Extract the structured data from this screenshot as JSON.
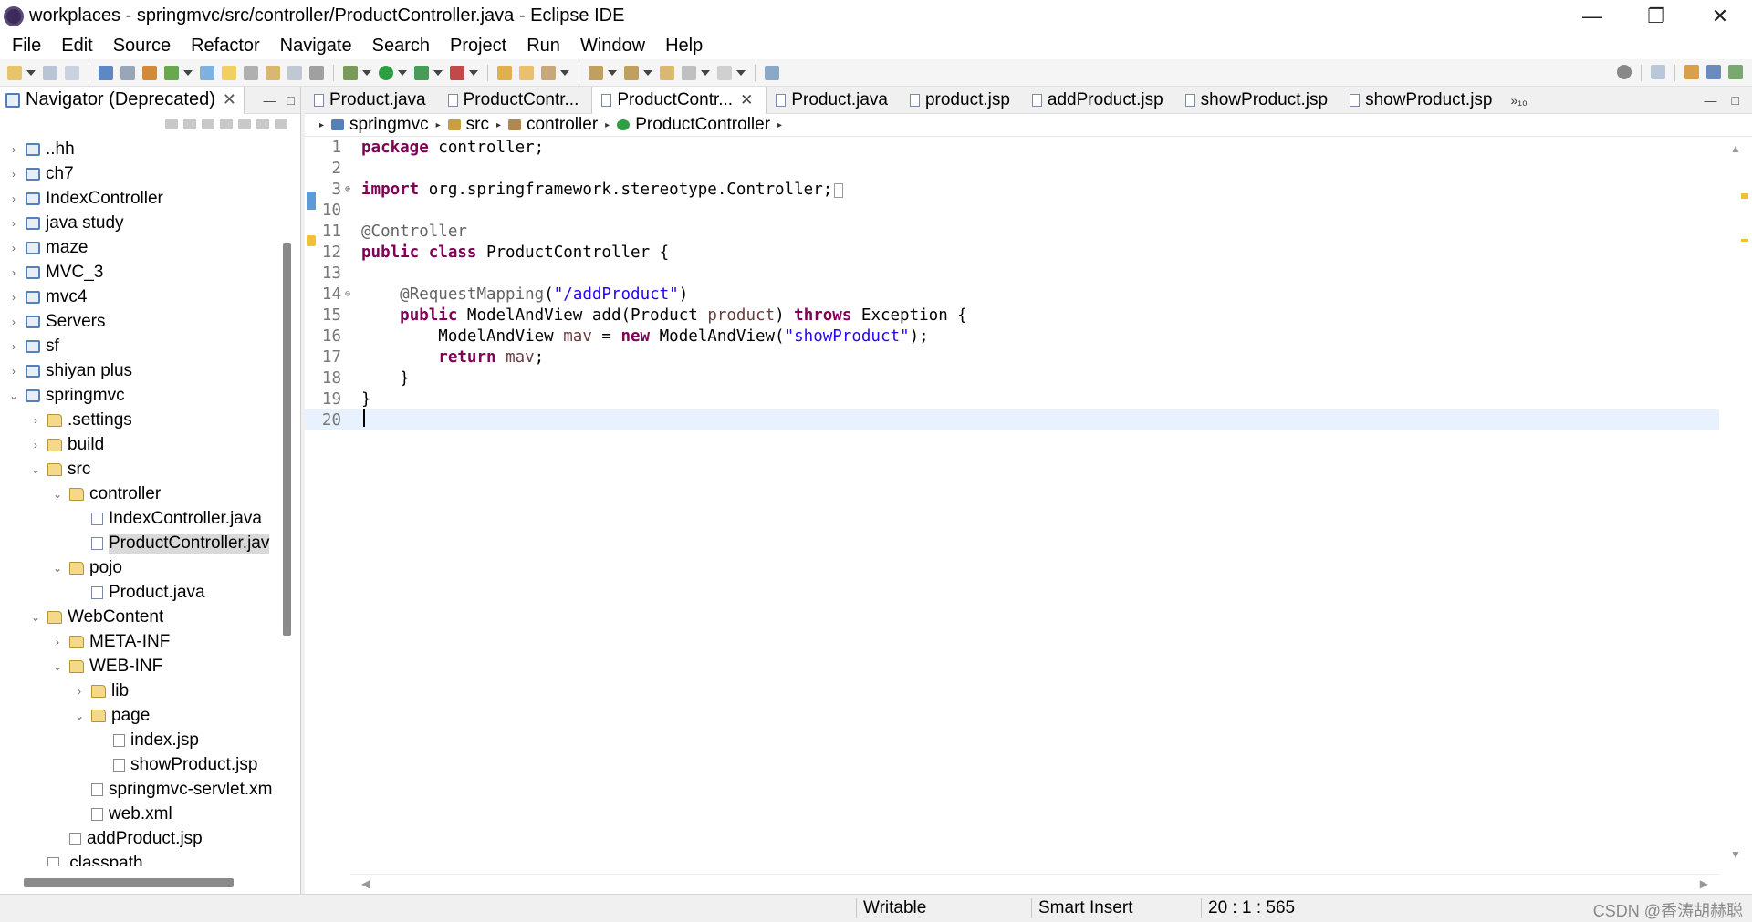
{
  "window": {
    "title": "workplaces - springmvc/src/controller/ProductController.java - Eclipse IDE",
    "buttons": [
      "—",
      "❐",
      "✕"
    ]
  },
  "menu": [
    "File",
    "Edit",
    "Source",
    "Refactor",
    "Navigate",
    "Search",
    "Project",
    "Run",
    "Window",
    "Help"
  ],
  "navigator": {
    "title": "Navigator (Deprecated)",
    "close": "✕",
    "minimize": "—",
    "maximize": "□",
    "tree": [
      {
        "label": "..hh",
        "level": 0,
        "icon": "project-icon",
        "twisty": "›"
      },
      {
        "label": "ch7",
        "level": 0,
        "icon": "project-icon",
        "twisty": "›"
      },
      {
        "label": "IndexController",
        "level": 0,
        "icon": "project-icon",
        "twisty": "›"
      },
      {
        "label": "java study",
        "level": 0,
        "icon": "project-icon",
        "twisty": "›"
      },
      {
        "label": "maze",
        "level": 0,
        "icon": "project-icon",
        "twisty": "›"
      },
      {
        "label": "MVC_3",
        "level": 0,
        "icon": "project-icon",
        "twisty": "›"
      },
      {
        "label": "mvc4",
        "level": 0,
        "icon": "project-icon",
        "twisty": "›"
      },
      {
        "label": "Servers",
        "level": 0,
        "icon": "project-icon",
        "twisty": "›"
      },
      {
        "label": "sf",
        "level": 0,
        "icon": "project-icon",
        "twisty": "›"
      },
      {
        "label": "shiyan plus",
        "level": 0,
        "icon": "project-icon",
        "twisty": "›"
      },
      {
        "label": "springmvc",
        "level": 0,
        "icon": "project-icon",
        "twisty": "⌄"
      },
      {
        "label": ".settings",
        "level": 1,
        "icon": "folder-icon",
        "twisty": "›"
      },
      {
        "label": "build",
        "level": 1,
        "icon": "folder-icon",
        "twisty": "›"
      },
      {
        "label": "src",
        "level": 1,
        "icon": "folder-icon",
        "twisty": "⌄"
      },
      {
        "label": "controller",
        "level": 2,
        "icon": "folder-icon",
        "twisty": "⌄"
      },
      {
        "label": "IndexController.java",
        "level": 3,
        "icon": "java-file-icon",
        "twisty": ""
      },
      {
        "label": "ProductController.jav",
        "level": 3,
        "icon": "java-file-icon",
        "twisty": "",
        "selected": true
      },
      {
        "label": "pojo",
        "level": 2,
        "icon": "folder-icon",
        "twisty": "⌄"
      },
      {
        "label": "Product.java",
        "level": 3,
        "icon": "java-file-icon",
        "twisty": ""
      },
      {
        "label": "WebContent",
        "level": 1,
        "icon": "folder-icon",
        "twisty": "⌄"
      },
      {
        "label": "META-INF",
        "level": 2,
        "icon": "folder-icon",
        "twisty": "›"
      },
      {
        "label": "WEB-INF",
        "level": 2,
        "icon": "folder-icon",
        "twisty": "⌄"
      },
      {
        "label": "lib",
        "level": 3,
        "icon": "folder-icon",
        "twisty": "›"
      },
      {
        "label": "page",
        "level": 3,
        "icon": "folder-icon",
        "twisty": "⌄"
      },
      {
        "label": "index.jsp",
        "level": 4,
        "icon": "file-icon",
        "twisty": ""
      },
      {
        "label": "showProduct.jsp",
        "level": 4,
        "icon": "file-icon",
        "twisty": ""
      },
      {
        "label": "springmvc-servlet.xm",
        "level": 3,
        "icon": "xml-file-icon",
        "twisty": ""
      },
      {
        "label": "web.xml",
        "level": 3,
        "icon": "xml-file-icon",
        "twisty": ""
      },
      {
        "label": "addProduct.jsp",
        "level": 2,
        "icon": "file-icon",
        "twisty": ""
      },
      {
        "label": ".classpath",
        "level": 1,
        "icon": "xml-file-icon",
        "twisty": ""
      }
    ]
  },
  "editor": {
    "tabs": [
      {
        "label": "Product.java",
        "active": false
      },
      {
        "label": "ProductContr...",
        "active": false
      },
      {
        "label": "ProductContr...",
        "active": true
      },
      {
        "label": "Product.java",
        "active": false
      },
      {
        "label": "product.jsp",
        "active": false
      },
      {
        "label": "addProduct.jsp",
        "active": false
      },
      {
        "label": "showProduct.jsp",
        "active": false
      },
      {
        "label": "showProduct.jsp",
        "active": false
      }
    ],
    "tab_close": "✕",
    "more_tabs": "»₁₀",
    "breadcrumb": [
      "springmvc",
      "src",
      "controller",
      "ProductController"
    ],
    "lines": [
      {
        "n": "1",
        "tokens": [
          [
            "kw",
            "package"
          ],
          [
            "",
            " controller;"
          ]
        ]
      },
      {
        "n": "2",
        "tokens": []
      },
      {
        "n": "3",
        "marker": "⊕",
        "tokens": [
          [
            "kw",
            "import"
          ],
          [
            "",
            " org.springframework.stereotype.Controller;"
          ],
          [
            "box",
            "□"
          ]
        ]
      },
      {
        "n": "10",
        "tokens": []
      },
      {
        "n": "11",
        "tokens": [
          [
            "ann",
            "@Controller"
          ]
        ]
      },
      {
        "n": "12",
        "tokens": [
          [
            "kw",
            "public"
          ],
          [
            "",
            " "
          ],
          [
            "kw",
            "class"
          ],
          [
            "",
            " ProductController {"
          ]
        ]
      },
      {
        "n": "13",
        "tokens": []
      },
      {
        "n": "14",
        "marker": "⊖",
        "tokens": [
          [
            "",
            "    "
          ],
          [
            "ann",
            "@RequestMapping"
          ],
          [
            "",
            "("
          ],
          [
            "str",
            "\"/addProduct\""
          ],
          [
            "",
            ")"
          ]
        ]
      },
      {
        "n": "15",
        "tokens": [
          [
            "",
            "    "
          ],
          [
            "kw",
            "public"
          ],
          [
            "",
            " ModelAndView add(Product "
          ],
          [
            "var",
            "product"
          ],
          [
            "",
            ") "
          ],
          [
            "kw",
            "throws"
          ],
          [
            "",
            " Exception {"
          ]
        ]
      },
      {
        "n": "16",
        "tokens": [
          [
            "",
            "        ModelAndView "
          ],
          [
            "var",
            "mav"
          ],
          [
            "",
            " = "
          ],
          [
            "kw",
            "new"
          ],
          [
            "",
            " ModelAndView("
          ],
          [
            "str",
            "\"showProduct\""
          ],
          [
            "",
            ");"
          ]
        ]
      },
      {
        "n": "17",
        "tokens": [
          [
            "",
            "        "
          ],
          [
            "kw",
            "return"
          ],
          [
            "",
            " "
          ],
          [
            "var",
            "mav"
          ],
          [
            "",
            ";"
          ]
        ]
      },
      {
        "n": "18",
        "tokens": [
          [
            "",
            "    }"
          ]
        ]
      },
      {
        "n": "19",
        "tokens": [
          [
            "",
            "}"
          ]
        ]
      },
      {
        "n": "20",
        "tokens": [],
        "current": true
      }
    ]
  },
  "status": {
    "writable": "Writable",
    "insert_mode": "Smart Insert",
    "position": "20 : 1 : 565",
    "watermark": "CSDN @香涛胡赫聪"
  },
  "colors": {
    "keyword": "#7f0055",
    "annotation": "#646464",
    "string": "#2a00ff",
    "variable": "#6a3e3e",
    "current_line": "#e8f2fe"
  }
}
